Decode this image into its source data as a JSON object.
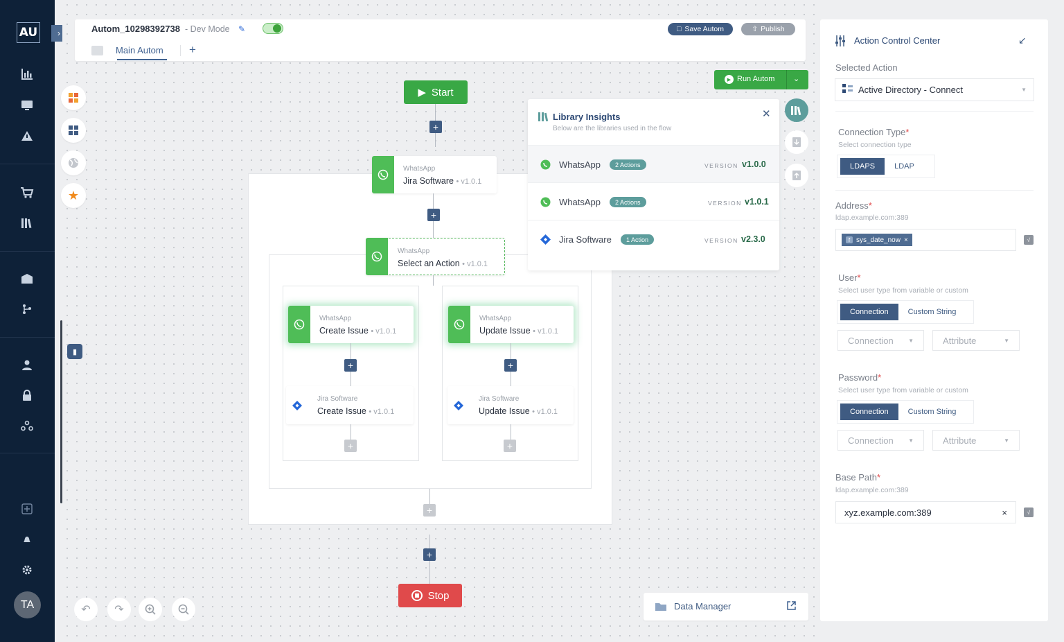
{
  "nav": {
    "logo": "AU",
    "avatar": "TA",
    "expand_icon": "chevron-right-icon"
  },
  "header": {
    "title": "Autom_10298392738",
    "mode": "- Dev Mode",
    "save_label": "Save Autom",
    "publish_label": "Publish",
    "tab_main": "Main Autom",
    "tab_add": "+"
  },
  "run": {
    "label": "Run Autom"
  },
  "flow": {
    "start": "Start",
    "stop": "Stop",
    "node1": {
      "category": "WhatsApp",
      "name": "Jira Software",
      "version": "v1.0.1"
    },
    "node2": {
      "category": "WhatsApp",
      "name": "Select an Action",
      "version": "v1.0.1"
    },
    "node3": {
      "category": "WhatsApp",
      "name": "Create Issue",
      "version": "v1.0.1"
    },
    "node4": {
      "category": "WhatsApp",
      "name": "Update Issue",
      "version": "v1.0.1"
    },
    "node5": {
      "category": "Jira Software",
      "name": "Create Issue",
      "version": "v1.0.1"
    },
    "node6": {
      "category": "Jira Software",
      "name": "Update Issue",
      "version": "v1.0.1"
    }
  },
  "library": {
    "title": "Library Insights",
    "subtitle": "Below are the libraries used in the flow",
    "version_label": "VERSION",
    "rows": [
      {
        "name": "WhatsApp",
        "badge": "2 Actions",
        "version": "v1.0.0"
      },
      {
        "name": "WhatsApp",
        "badge": "2 Actions",
        "version": "v1.0.1"
      },
      {
        "name": "Jira Software",
        "badge": "1 Action",
        "version": "v2.3.0"
      }
    ]
  },
  "data_manager": {
    "label": "Data Manager"
  },
  "panel": {
    "title": "Action Control Center",
    "selected_action_label": "Selected Action",
    "selected_action": "Active Directory - Connect",
    "connection_type": {
      "label": "Connection Type",
      "hint": "Select connection type",
      "options": [
        "LDAPS",
        "LDAP"
      ]
    },
    "address": {
      "label": "Address",
      "hint": "ldap.example.com:389",
      "chip": "sys_date_now"
    },
    "user": {
      "label": "User",
      "hint": "Select user type from variable or custom",
      "options": [
        "Connection",
        "Custom String"
      ],
      "dd1": "Connection",
      "dd2": "Attribute"
    },
    "password": {
      "label": "Password",
      "hint": "Select user type from variable or custom",
      "options": [
        "Connection",
        "Custom String"
      ],
      "dd1": "Connection",
      "dd2": "Attribute"
    },
    "base_path": {
      "label": "Base Path",
      "hint": "ldap.example.com:389",
      "value": "xyz.example.com:389"
    }
  },
  "colors": {
    "nav_bg": "#0e2138",
    "accent": "#3f5b82",
    "green": "#39a845",
    "red": "#e04a4b",
    "whatsapp": "#4fbd57"
  }
}
